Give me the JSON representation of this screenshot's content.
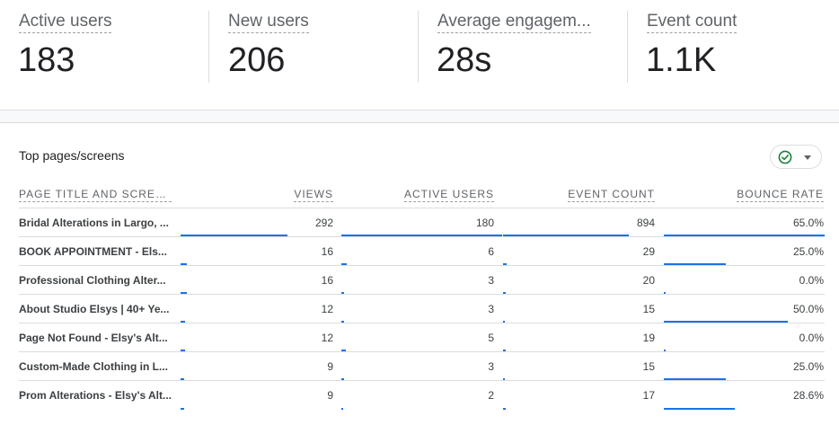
{
  "metrics": [
    {
      "label": "Active users",
      "value": "183"
    },
    {
      "label": "New users",
      "value": "206"
    },
    {
      "label": "Average engagem...",
      "value": "28s"
    },
    {
      "label": "Event count",
      "value": "1.1K"
    }
  ],
  "card": {
    "title": "Top pages/screens",
    "status_icon": "check-circle-icon",
    "dropdown_icon": "caret-down-icon"
  },
  "table": {
    "columns": [
      "PAGE TITLE AND SCREEN...",
      "VIEWS",
      "ACTIVE USERS",
      "EVENT COUNT",
      "BOUNCE RATE"
    ],
    "rows": [
      {
        "title": "Bridal Alterations in Largo, ...",
        "views": "292",
        "active_users": "180",
        "event_count": "894",
        "bounce_rate": "65.0%"
      },
      {
        "title": "BOOK APPOINTMENT - Els...",
        "views": "16",
        "active_users": "6",
        "event_count": "29",
        "bounce_rate": "25.0%"
      },
      {
        "title": "Professional Clothing Alter...",
        "views": "16",
        "active_users": "3",
        "event_count": "20",
        "bounce_rate": "0.0%"
      },
      {
        "title": "About Studio Elsys | 40+ Ye...",
        "views": "12",
        "active_users": "3",
        "event_count": "15",
        "bounce_rate": "50.0%"
      },
      {
        "title": "Page Not Found - Elsy's Alt...",
        "views": "12",
        "active_users": "5",
        "event_count": "19",
        "bounce_rate": "0.0%"
      },
      {
        "title": "Custom-Made Clothing in L...",
        "views": "9",
        "active_users": "3",
        "event_count": "15",
        "bounce_rate": "25.0%"
      },
      {
        "title": "Prom Alterations - Elsy's Alt...",
        "views": "9",
        "active_users": "2",
        "event_count": "17",
        "bounce_rate": "28.6%"
      }
    ],
    "bar_fraction": {
      "views": [
        1.0,
        0.055,
        0.055,
        0.041,
        0.041,
        0.031,
        0.031
      ],
      "active_users": [
        1.0,
        0.033,
        0.017,
        0.017,
        0.028,
        0.017,
        0.011
      ],
      "event_count": [
        1.0,
        0.032,
        0.022,
        0.017,
        0.021,
        0.017,
        0.019
      ],
      "bounce_rate": [
        1.0,
        0.385,
        0.0,
        0.769,
        0.0,
        0.385,
        0.44
      ]
    }
  },
  "colors": {
    "accent": "#1a73e8",
    "check_green": "#188038"
  }
}
